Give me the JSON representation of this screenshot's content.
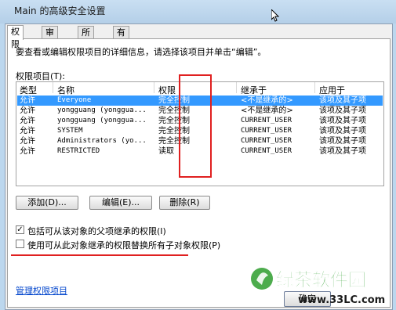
{
  "window": {
    "title": "Main 的高级安全设置"
  },
  "tabs": [
    "权限",
    "审核",
    "所有者",
    "有效权限"
  ],
  "active_tab": 0,
  "description": "要查看或编辑权限项目的详细信息，请选择该项目并单击“编辑”。",
  "list_label": "权限项目(T):",
  "columns": [
    "类型",
    "名称",
    "权限",
    "继承于",
    "应用于"
  ],
  "rows": [
    {
      "type": "允许",
      "name": "Everyone",
      "permission": "完全控制",
      "inherited": "<不是继承的>",
      "applies": "该项及其子项"
    },
    {
      "type": "允许",
      "name": "yongguang (yonggua...",
      "permission": "完全控制",
      "inherited": "<不是继承的>",
      "applies": "该项及其子项"
    },
    {
      "type": "允许",
      "name": "yongguang (yonggua...",
      "permission": "完全控制",
      "inherited": "CURRENT_USER",
      "applies": "该项及其子项"
    },
    {
      "type": "允许",
      "name": "SYSTEM",
      "permission": "完全控制",
      "inherited": "CURRENT_USER",
      "applies": "该项及其子项"
    },
    {
      "type": "允许",
      "name": "Administrators (yo...",
      "permission": "完全控制",
      "inherited": "CURRENT_USER",
      "applies": "该项及其子项"
    },
    {
      "type": "允许",
      "name": "RESTRICTED",
      "permission": "读取",
      "inherited": "CURRENT_USER",
      "applies": "该项及其子项"
    }
  ],
  "selected_row": 0,
  "buttons": {
    "add": "添加(D)...",
    "edit": "编辑(E)...",
    "remove": "删除(R)"
  },
  "checkboxes": [
    {
      "label": "包括可从该对象的父项继承的权限(I)",
      "checked": true
    },
    {
      "label": "使用可从此对象继承的权限替换所有子对象权限(P)",
      "checked": false
    }
  ],
  "manage_link": "管理权限项目",
  "ok_button": "确定",
  "watermark": {
    "text": "绿茶软件园",
    "url": "www.33LC.com"
  },
  "colors": {
    "selection": "#3399ff",
    "annotation": "#e02020",
    "watermark": "#2e9e2e"
  }
}
